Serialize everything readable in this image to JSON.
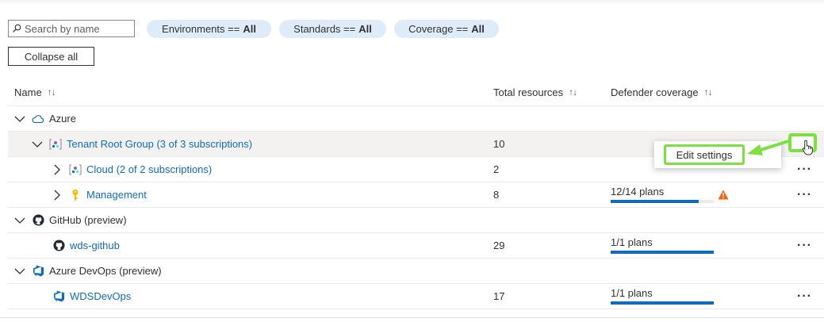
{
  "toolbar": {
    "search_placeholder": "Search by name",
    "filters": [
      {
        "label": "Environments ==",
        "value": "All"
      },
      {
        "label": "Standards ==",
        "value": "All"
      },
      {
        "label": "Coverage ==",
        "value": "All"
      }
    ],
    "collapse_label": "Collapse all"
  },
  "columns": {
    "name": "Name",
    "total": "Total resources",
    "coverage": "Defender coverage"
  },
  "rows": [
    {
      "label": "Azure",
      "kind": "group"
    },
    {
      "label": "Tenant Root Group (3 of 3 subscriptions)",
      "total": "10"
    },
    {
      "label": "Cloud (2 of 2 subscriptions)",
      "total": "2"
    },
    {
      "label": "Management",
      "total": "8",
      "coverage": "12/14 plans",
      "coverage_fraction": 0.857,
      "warning": true
    },
    {
      "label": "GitHub (preview)",
      "kind": "group"
    },
    {
      "label": "wds-github",
      "total": "29",
      "coverage": "1/1 plans",
      "coverage_fraction": 1.0
    },
    {
      "label": "Azure DevOps (preview)",
      "kind": "group"
    },
    {
      "label": "WDSDevOps",
      "total": "17",
      "coverage": "1/1 plans",
      "coverage_fraction": 1.0
    }
  ],
  "context_menu": {
    "item": "Edit settings"
  },
  "colors": {
    "link": "#0f6cbd",
    "highlight": "#7be040",
    "warning": "#f7630c",
    "pill": "#deecf9"
  }
}
